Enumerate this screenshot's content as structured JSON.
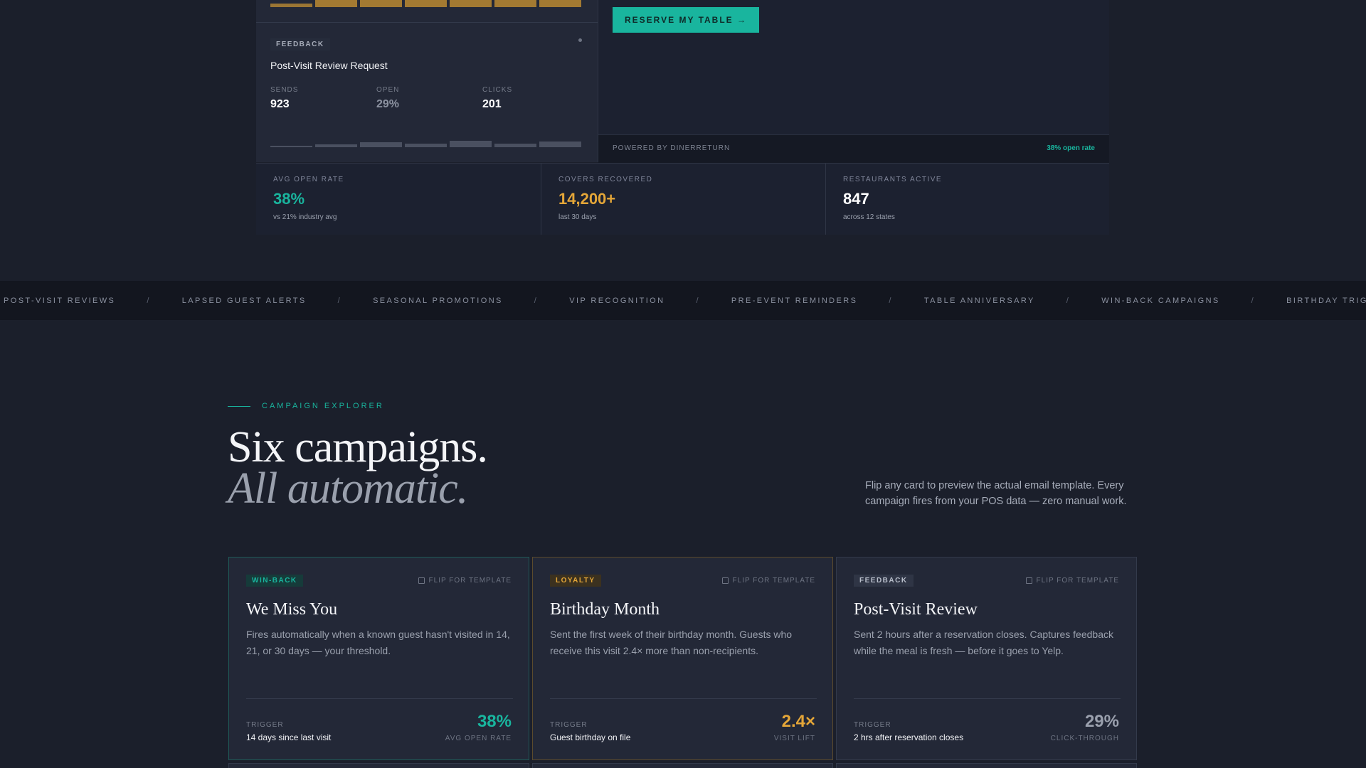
{
  "preview": {
    "feedback_badge": "FEEDBACK",
    "feedback_title": "Post-Visit Review Request",
    "stats": [
      {
        "label": "SENDS",
        "value": "923"
      },
      {
        "label": "OPEN",
        "value": "29%"
      },
      {
        "label": "CLICKS",
        "value": "201"
      }
    ],
    "reserve_button": "RESERVE MY TABLE →",
    "powered_by": "POWERED BY DINERRETURN",
    "open_rate_note": "38% open rate"
  },
  "metrics": [
    {
      "label": "AVG OPEN RATE",
      "value": "38%",
      "sub": "vs 21% industry avg",
      "color": "#19b59e"
    },
    {
      "label": "COVERS RECOVERED",
      "value": "14,200+",
      "sub": "last 30 days",
      "color": "#e4a638"
    },
    {
      "label": "RESTAURANTS ACTIVE",
      "value": "847",
      "sub": "across 12 states",
      "color": "#ffffff"
    }
  ],
  "ticker": [
    "POST-VISIT REVIEWS",
    "LAPSED GUEST ALERTS",
    "SEASONAL PROMOTIONS",
    "VIP RECOGNITION",
    "PRE-EVENT REMINDERS",
    "TABLE ANNIVERSARY",
    "WIN-BACK CAMPAIGNS",
    "BIRTHDAY TRIGGERS"
  ],
  "ticker_separator": "/",
  "explorer": {
    "eyebrow": "CAMPAIGN EXPLORER",
    "headline": "Six campaigns.",
    "headline_italic": "All automatic.",
    "lead": "Flip any card to preview the actual email template. Every campaign fires from your POS data — zero manual work."
  },
  "cards": [
    {
      "tag": "WIN-BACK",
      "flip": "FLIP FOR TEMPLATE",
      "title": "We Miss You",
      "desc": "Fires automatically when a known guest hasn't visited in 14, 21, or 30 days — your threshold.",
      "trigger_label": "TRIGGER",
      "trigger": "14 days since last visit",
      "metric": "38%",
      "metric_label": "AVG OPEN RATE",
      "color": "#19b59e"
    },
    {
      "tag": "LOYALTY",
      "flip": "FLIP FOR TEMPLATE",
      "title": "Birthday Month",
      "desc": "Sent the first week of their birthday month. Guests who receive this visit 2.4× more than non-recipients.",
      "trigger_label": "TRIGGER",
      "trigger": "Guest birthday on file",
      "metric": "2.4×",
      "metric_label": "VISIT LIFT",
      "color": "#e4a638"
    },
    {
      "tag": "FEEDBACK",
      "flip": "FLIP FOR TEMPLATE",
      "title": "Post-Visit Review",
      "desc": "Sent 2 hours after a reservation closes. Captures feedback while the meal is fresh — before it goes to Yelp.",
      "trigger_label": "TRIGGER",
      "trigger": "2 hrs after reservation closes",
      "metric": "29%",
      "metric_label": "CLICK-THROUGH",
      "color": "#9aa0ad"
    }
  ],
  "icons": {
    "flip": "flip-card-icon",
    "dot": "status-dot-icon"
  }
}
